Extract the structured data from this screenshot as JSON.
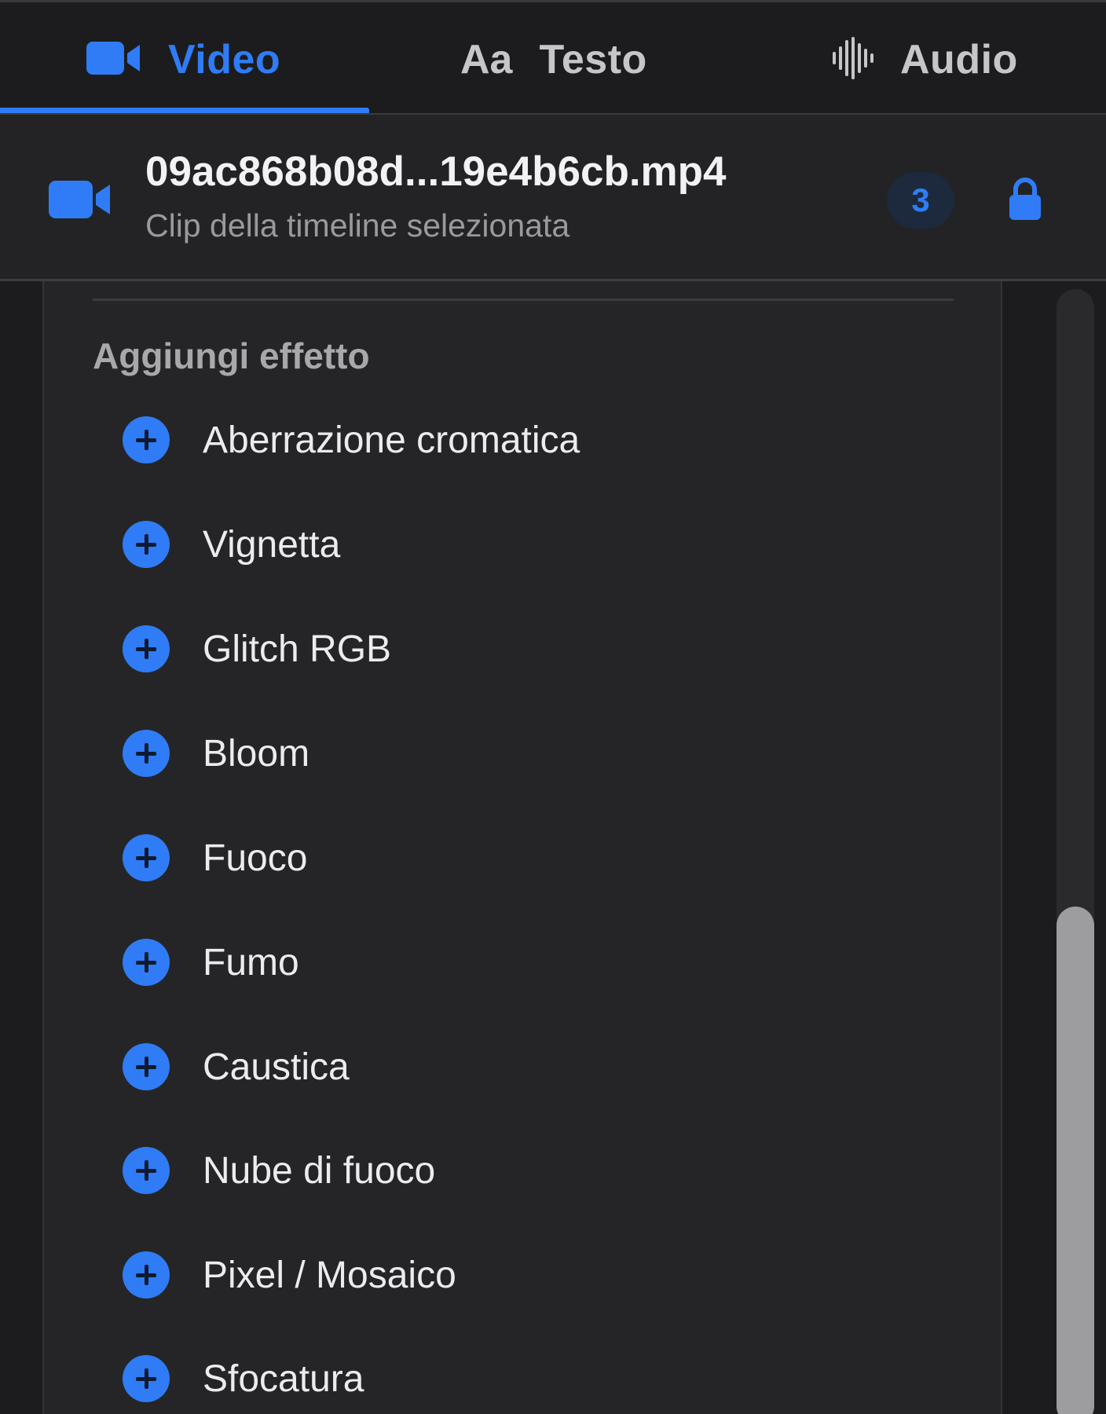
{
  "tabs": [
    {
      "label": "Video",
      "icon": "video-camera-icon",
      "active": true
    },
    {
      "label": "Testo",
      "icon_text": "Aa",
      "active": false
    },
    {
      "label": "Audio",
      "icon": "audio-waveform-icon",
      "active": false
    }
  ],
  "clip": {
    "filename": "09ac868b08d...19e4b6cb.mp4",
    "subtitle": "Clip della timeline selezionata",
    "badge": "3",
    "icon": "video-camera-icon",
    "lock_icon": "lock-icon"
  },
  "effects_section": {
    "title": "Aggiungi effetto",
    "items": [
      {
        "label": "Aberrazione cromatica"
      },
      {
        "label": "Vignetta"
      },
      {
        "label": "Glitch RGB"
      },
      {
        "label": "Bloom"
      },
      {
        "label": "Fuoco"
      },
      {
        "label": "Fumo"
      },
      {
        "label": "Caustica"
      },
      {
        "label": "Nube di fuoco"
      },
      {
        "label": "Pixel / Mosaico"
      },
      {
        "label": "Sfocatura"
      }
    ]
  },
  "colors": {
    "accent": "#2f7cf6",
    "background": "#1c1c1e",
    "panel": "#252527"
  }
}
